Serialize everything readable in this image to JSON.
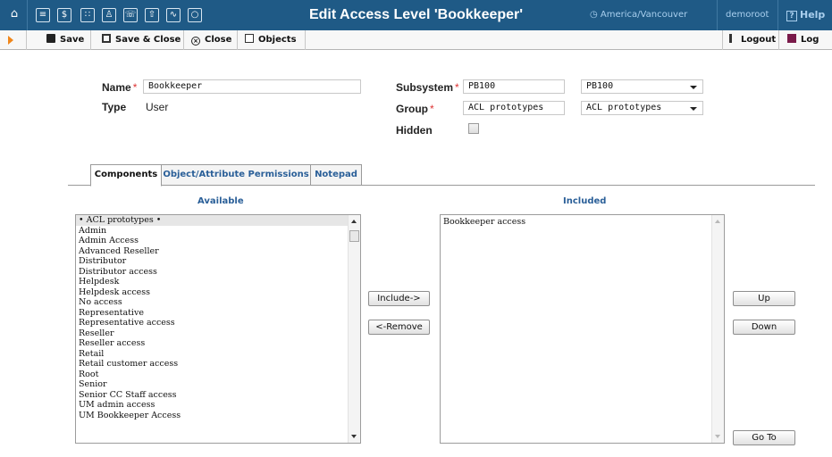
{
  "window": {
    "title": "Edit Access Level 'Bookkeeper'",
    "timezone": "America/Vancouver",
    "user": "demoroot",
    "help_label": "Help"
  },
  "toolbar": {
    "save": "Save",
    "save_close": "Save & Close",
    "close": "Close",
    "objects": "Objects",
    "logout": "Logout",
    "log": "Log"
  },
  "form": {
    "name_label": "Name",
    "name_value": "Bookkeeper",
    "type_label": "Type",
    "type_value": "User",
    "subsystem_label": "Subsystem",
    "subsystem_value": "PB100",
    "subsystem_select": "PB100",
    "group_label": "Group",
    "group_value": "ACL prototypes",
    "group_select": "ACL prototypes",
    "hidden_label": "Hidden",
    "required_mark": "*"
  },
  "tabs": [
    {
      "label": "Components",
      "active": true
    },
    {
      "label": "Object/Attribute Permissions",
      "active": false
    },
    {
      "label": "Notepad",
      "active": false
    }
  ],
  "components": {
    "available_header": "Available",
    "included_header": "Included",
    "available": [
      "• ACL prototypes •",
      "Admin",
      "Admin Access",
      "Advanced Reseller",
      "Distributor",
      "Distributor access",
      "Helpdesk",
      "Helpdesk access",
      "No access",
      "Representative",
      "Representative access",
      "Reseller",
      "Reseller access",
      "Retail",
      "Retail customer access",
      "Root",
      "Senior",
      "Senior CC Staff access",
      "UM admin access",
      "UM Bookkeeper Access"
    ],
    "included": [
      "Bookkeeper access"
    ],
    "include_button": "Include->",
    "remove_button": "<-Remove",
    "up_button": "Up",
    "down_button": "Down",
    "goto_button": "Go To"
  }
}
